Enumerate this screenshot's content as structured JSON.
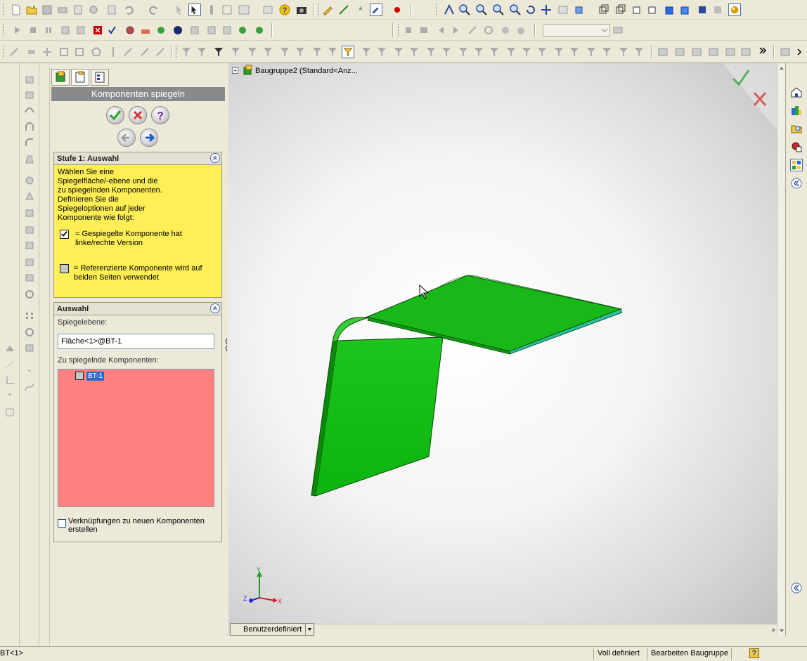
{
  "property_manager": {
    "title": "Komponenten spiegeln",
    "step1": {
      "header": "Stufe 1: Auswahl",
      "instructions": [
        "Wählen Sie eine",
        "Spiegelfläche/-ebene und die",
        "zu spiegelnden Komponenten.",
        "Definieren Sie die",
        "Spiegeloptionen auf jeder",
        "Komponente wie folgt:"
      ],
      "legend_checked_line1": "= Gespiegelte Komponente hat",
      "legend_checked_line2": "linke/rechte Version",
      "legend_unchecked_line1": "= Referenzierte Komponente wird auf",
      "legend_unchecked_line2": "beiden Seiten verwendet"
    },
    "selection": {
      "header": "Auswahl",
      "mirror_plane_label": "Spiegelebene:",
      "mirror_plane_value": "Fläche<1>@BT-1",
      "components_label": "Zu spiegelnde Komponenten:",
      "component_item": "BT-1",
      "create_mates_line1": "Verknüpfungen zu neuen Komponenten",
      "create_mates_line2": "erstellen"
    }
  },
  "viewport": {
    "tree_header": "Baugruppe2  (Standard<Anz...",
    "view_orientation": "Benutzerdefiniert",
    "triad": {
      "x": "X",
      "y": "Y",
      "z": "Z"
    }
  },
  "status_bar": {
    "selection": "BT<1>",
    "definition": "Voll definiert",
    "mode": "Bearbeiten Baugruppe",
    "help": "?"
  },
  "colors": {
    "part_green": "#12c012",
    "step1_bg": "#ffee55",
    "listbox_bg": "#ff8080",
    "title_bar": "#8a8a8a",
    "accept": "#2ca02c",
    "cancel": "#d83030"
  }
}
